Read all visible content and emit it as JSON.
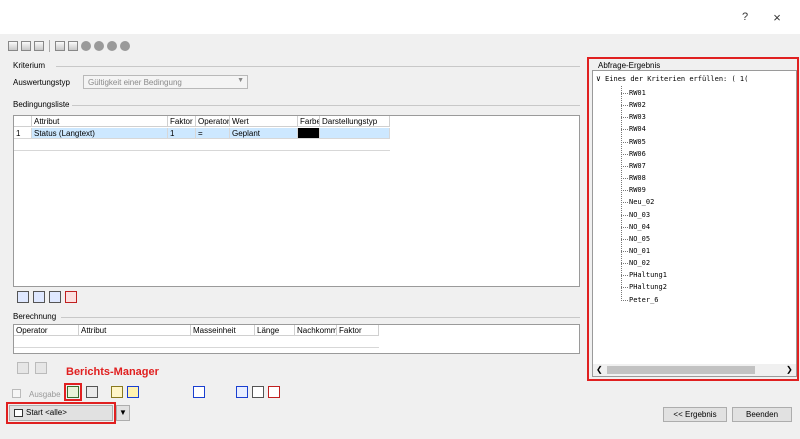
{
  "window": {
    "help_glyph": "?",
    "close_glyph": "×"
  },
  "kriterium": {
    "title": "Kriterium",
    "auswertungstyp_label": "Auswertungstyp",
    "auswertungstyp_value": "Gültigkeit einer Bedingung"
  },
  "bedingungsliste": {
    "title": "Bedingungsliste",
    "columns": [
      "Attribut",
      "Faktor",
      "Operator",
      "Wert",
      "Farbe",
      "Darstellungstyp"
    ],
    "rows": [
      {
        "num": "1",
        "attribut": "Status (Langtext)",
        "faktor": "1",
        "operator": "=",
        "wert": "Geplant",
        "farbe": "#000000",
        "darstellungstyp": ""
      }
    ]
  },
  "berechnung": {
    "title": "Berechnung",
    "columns": [
      "Operator",
      "Attribut",
      "Masseinheit",
      "Länge",
      "Nachkomma",
      "Faktor"
    ]
  },
  "abfrage": {
    "title": "Abfrage-Ergebnis",
    "root": "Eines der Kriterien erfüllen: ( 1(",
    "items": [
      "RW01",
      "RW02",
      "RW03",
      "RW04",
      "RW05",
      "RW06",
      "RW07",
      "RW08",
      "RW09",
      "Neu_02",
      "NO_03",
      "NO_04",
      "NO_05",
      "NO_01",
      "NO_02",
      "PHaltung1",
      "PHaltung2",
      "Peter_6"
    ]
  },
  "annotation": {
    "label": "Berichts-Manager",
    "color": "#e02020"
  },
  "bottom": {
    "ausgabe_label": "Ausgabe",
    "start_label": "Start <alle>",
    "ergebnis_label": "<< Ergebnis",
    "beenden_label": "Beenden"
  },
  "colors": {
    "selection": "#cde8ff",
    "highlight": "#e02020",
    "link_blue": "#1a3fd0"
  }
}
